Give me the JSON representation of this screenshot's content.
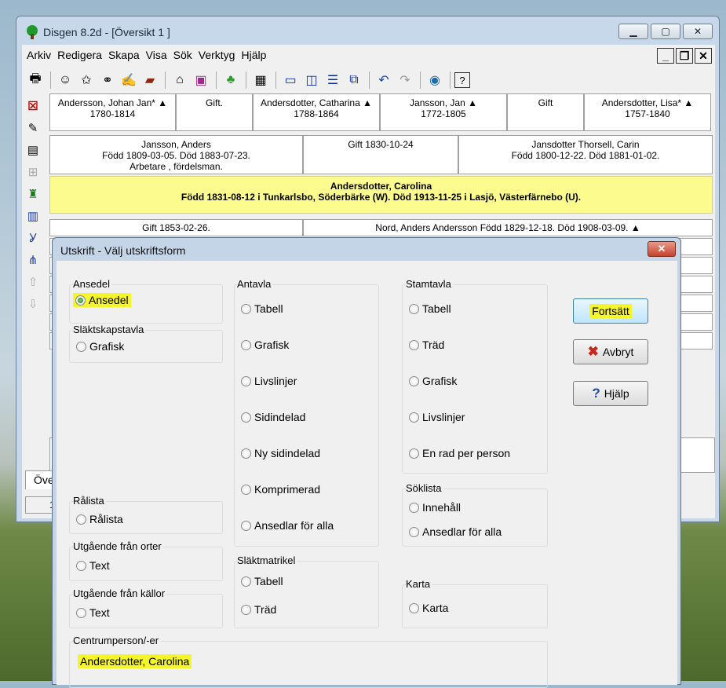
{
  "window": {
    "title": "Disgen 8.2d - [Översikt 1 ]",
    "caption_buttons": [
      "minimize-icon",
      "maximize-icon",
      "close-icon"
    ],
    "mdi_buttons": [
      "_",
      "❐",
      "✕"
    ]
  },
  "menu": [
    "Arkiv",
    "Redigera",
    "Skapa",
    "Visa",
    "Sök",
    "Verktyg",
    "Hjälp"
  ],
  "toolbar": [
    "printer",
    "person",
    "person-star",
    "binoculars",
    "edit-hand",
    "book",
    "home",
    "contacts",
    "tree",
    "calendar",
    "layout-1",
    "layout-2",
    "layout-3",
    "layout-4",
    "undo",
    "redo",
    "globe",
    "help"
  ],
  "tree": {
    "row1": [
      {
        "name": "Andersson, Johan Jan* ▲",
        "years": "1780-1814"
      },
      {
        "name": "Gift.",
        "years": ""
      },
      {
        "name": "Andersdotter, Catharina ▲",
        "years": "1788-1864"
      },
      {
        "name": "Jansson, Jan ▲",
        "years": "1772-1805"
      },
      {
        "name": "Gift",
        "years": ""
      },
      {
        "name": "Andersdotter, Lisa* ▲",
        "years": "1757-1840"
      }
    ],
    "father": {
      "l1": "Jansson, Anders",
      "l2": "Född 1809-03-05. Död 1883-07-23.",
      "l3": "Arbetare , fördelsman."
    },
    "marriage": "Gift 1830-10-24",
    "mother": {
      "l1": "Jansdotter Thorsell, Carin",
      "l2": "Född 1800-12-22. Död 1881-01-02."
    },
    "main": {
      "name": "Andersdotter, Carolina",
      "info": "Född 1831-08-12 i Tunkarlsbo, Söderbärke (W). Död 1913-11-25 i Lasjö, Västerfärnebo (U)."
    },
    "spouse_marriage": "Gift 1853-02-26.",
    "spouse": "Nord, Anders Andersson Född 1829-12-18. Död 1908-03-09. ▲",
    "tab": "Öve",
    "status": "1"
  },
  "dialog": {
    "title": "Utskrift - Välj utskriftsform",
    "groups": {
      "ansedel": {
        "label": "Ansedel",
        "options": [
          "Ansedel"
        ]
      },
      "slaktskap": {
        "label": "Släktskapstavla",
        "options": [
          "Grafisk"
        ]
      },
      "ralista": {
        "label": "Rålista",
        "options": [
          "Rålista"
        ]
      },
      "orter": {
        "label": "Utgående från orter",
        "options": [
          "Text"
        ]
      },
      "kallor": {
        "label": "Utgående från källor",
        "options": [
          "Text"
        ]
      },
      "antavla": {
        "label": "Antavla",
        "options": [
          "Tabell",
          "Grafisk",
          "Livslinjer",
          "Sidindelad",
          "Ny sidindelad",
          "Komprimerad",
          "Ansedlar för alla"
        ]
      },
      "matrikel": {
        "label": "Släktmatrikel",
        "options": [
          "Tabell",
          "Träd"
        ]
      },
      "stamtavla": {
        "label": "Stamtavla",
        "options": [
          "Tabell",
          "Träd",
          "Grafisk",
          "Livslinjer",
          "En rad per person"
        ]
      },
      "soklista": {
        "label": "Söklista",
        "options": [
          "Innehåll",
          "Ansedlar för alla"
        ]
      },
      "karta": {
        "label": "Karta",
        "options": [
          "Karta"
        ]
      },
      "centrum": {
        "label": "Centrumperson/-er",
        "value": "Andersdotter, Carolina"
      }
    },
    "buttons": {
      "continue": "Fortsätt",
      "cancel": "Avbryt",
      "help": "Hjälp"
    },
    "selected": "Ansedel"
  },
  "colors": {
    "highlight": "#f4f52a",
    "main_person_bg": "#fbfb8e",
    "dialog_frame": "#c4d5e8"
  }
}
